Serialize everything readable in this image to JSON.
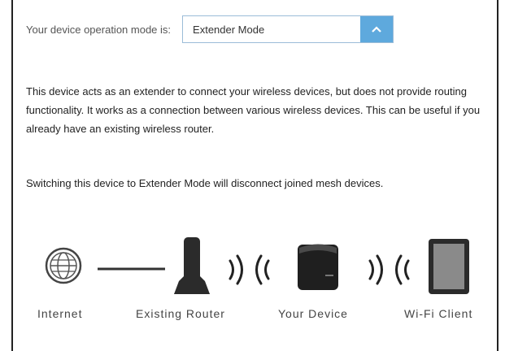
{
  "mode": {
    "label": "Your device operation mode is:",
    "value": "Extender Mode"
  },
  "description": {
    "paragraph1": "This device acts as an extender to connect your wireless devices, but does not provide routing functionality. It works as a connection between various wireless devices. This can be useful if you already have an existing wireless router.",
    "paragraph2": "Switching this device to Extender Mode will disconnect joined mesh devices."
  },
  "diagram": {
    "captions": [
      "Internet",
      "Existing Router",
      "Your Device",
      "Wi-Fi Client"
    ],
    "icons": [
      "globe-icon",
      "router-icon",
      "device-icon",
      "tablet-icon"
    ]
  },
  "colors": {
    "accent": "#5ea9dd",
    "select_border": "#9bbcd8",
    "icon_dark": "#222222"
  }
}
